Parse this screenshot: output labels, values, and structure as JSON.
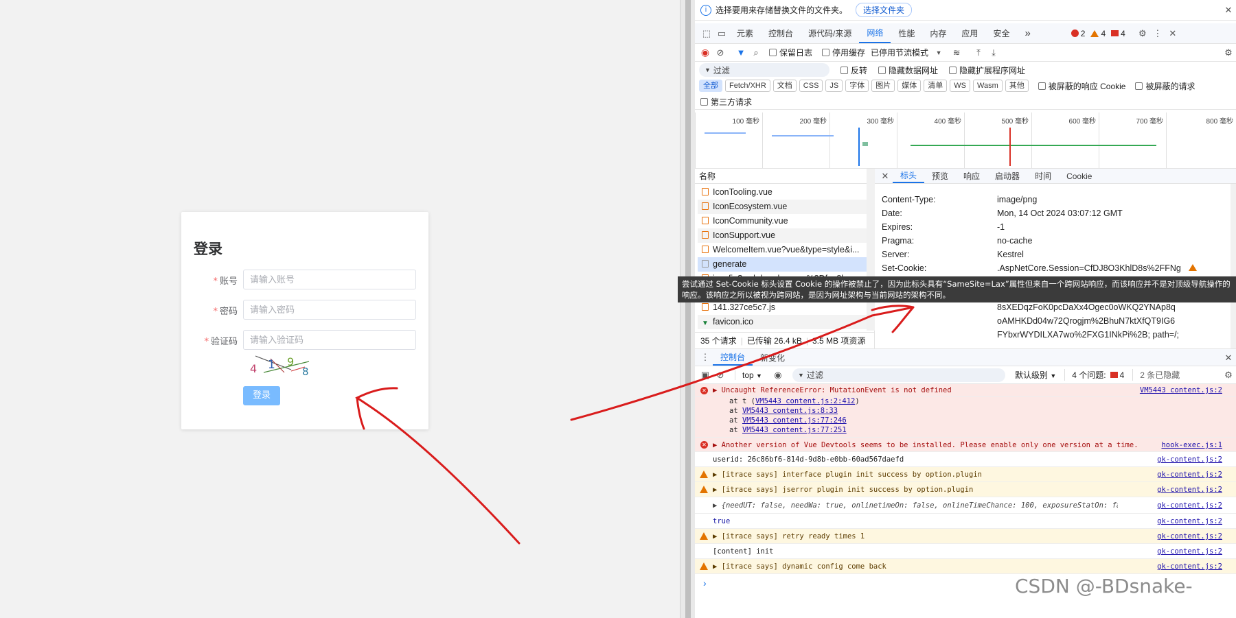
{
  "login": {
    "title": "登录",
    "required_mark": "*",
    "account_label": "账号",
    "account_placeholder": "请输入账号",
    "password_label": "密码",
    "password_placeholder": "请输入密码",
    "captcha_label": "验证码",
    "captcha_placeholder": "请输入验证码",
    "captcha_chars": [
      "4",
      "1",
      "9",
      "8"
    ],
    "submit_label": "登录"
  },
  "devtools": {
    "info_message": "选择要用来存储替换文件的文件夹。",
    "info_button": "选择文件夹",
    "tabs": [
      "元素",
      "控制台",
      "源代码/来源",
      "网络",
      "性能",
      "内存",
      "应用",
      "安全"
    ],
    "active_tab": "网络",
    "more_tabs": "»",
    "error_count": "2",
    "warning_count": "4",
    "issue_count": "4",
    "toolbar": {
      "preserve_log": "保留日志",
      "disable_cache": "停用缓存",
      "throttling": "已停用节流模式"
    },
    "filter": {
      "placeholder": "过滤",
      "invert": "反转",
      "hide_data_urls": "隐藏数据网址",
      "hide_extension_urls": "隐藏扩展程序网址"
    },
    "type_chips": [
      "全部",
      "Fetch/XHR",
      "文档",
      "CSS",
      "JS",
      "字体",
      "图片",
      "媒体",
      "清单",
      "WS",
      "Wasm",
      "其他"
    ],
    "blocked_cookies": "被屏蔽的响应 Cookie",
    "blocked_requests": "被屏蔽的请求",
    "third_party": "第三方请求",
    "timeline_ticks": [
      "100 毫秒",
      "200 毫秒",
      "300 毫秒",
      "400 毫秒",
      "500 毫秒",
      "600 毫秒",
      "700 毫秒",
      "800 毫秒"
    ],
    "name_header": "名称",
    "requests": [
      "IconTooling.vue",
      "IconEcosystem.vue",
      "IconCommunity.vue",
      "IconSupport.vue",
      "WelcomeItem.vue?vue&type=style&i...",
      "generate",
      "iconfig?wpk-header=app%3Dfqy8bg...",
      "",
      "141.327ce5c7.js",
      "favicon.ico"
    ],
    "selected_request": "generate",
    "status_bar": {
      "count": "35 个请求",
      "transferred": "已传输 26.4 kB",
      "resources": "3.5 MB 项资源"
    },
    "detail_tabs": [
      "标头",
      "预览",
      "响应",
      "启动器",
      "时间",
      "Cookie"
    ],
    "headers": [
      {
        "k": "Content-Type:",
        "v": "image/png"
      },
      {
        "k": "Date:",
        "v": "Mon, 14 Oct 2024 03:07:12 GMT"
      },
      {
        "k": "Expires:",
        "v": "-1"
      },
      {
        "k": "Pragma:",
        "v": "no-cache"
      },
      {
        "k": "Server:",
        "v": "Kestrel"
      },
      {
        "k": "Set-Cookie:",
        "v": ".AspNetCore.Session=CfDJ8O3KhlD8s%2FFNg"
      }
    ],
    "cookie_continuation": [
      "8sXEDqzFoK0pcDaXx4Ogec0oWKQ2YNAp8q",
      "oAMHKDd04w72Qrogjm%2BhuN7ktXfQT9IG6",
      "FYbxrWYDILXA7wo%2FXG1INkPi%2B; path=/;"
    ],
    "tooltip": "尝试通过 Set-Cookie 标头设置 Cookie 的操作被禁止了，因为此标头具有“SameSite=Lax”属性但来自一个跨网站响应，而该响应并不是对顶级导航操作的响应。该响应之所以被视为跨网站，是因为网址架构与当前网站的架构不同。",
    "drawer_tabs": [
      "控制台",
      "新变化"
    ],
    "console_toolbar": {
      "context": "top",
      "filter_placeholder": "过滤",
      "levels": "默认级别",
      "issues_label": "4 个问题:",
      "issues_count": "4",
      "hidden": "2 条已隐藏"
    },
    "console": [
      {
        "level": "error",
        "msg": "▶ Uncaught ReferenceError: MutationEvent is not defined",
        "src": "VM5443 content.js:2"
      },
      {
        "level": "stack",
        "msg": "at t (",
        "link": "VM5443 content.js:2:412",
        "tail": ")"
      },
      {
        "level": "stack",
        "msg": "at ",
        "link": "VM5443 content.js:8:33",
        "tail": ""
      },
      {
        "level": "stack",
        "msg": "at ",
        "link": "VM5443 content.js:77:246",
        "tail": ""
      },
      {
        "level": "stack",
        "msg": "at ",
        "link": "VM5443 content.js:77:251",
        "tail": ""
      },
      {
        "level": "error",
        "msg": "▶ Another version of Vue Devtools seems to be installed. Please enable only one version at a time.",
        "src": "hook-exec.js:1"
      },
      {
        "level": "info",
        "msg": "userid: 26c86bf6-814d-9d8b-e0bb-60ad567daefd",
        "src": "gk-content.js:2"
      },
      {
        "level": "warn",
        "msg": "▶ [itrace says] interface plugin init success by option.plugin",
        "src": "gk-content.js:2"
      },
      {
        "level": "warn",
        "msg": "▶ [itrace says] jserror plugin init success by option.plugin",
        "src": "gk-content.js:2"
      },
      {
        "level": "info",
        "msg": "▶ {needUT: false, needWa: true, onlinetimeOn: false, onlineTimeChance: 100, exposureStatOn: false, …}",
        "src": "gk-content.js:2"
      },
      {
        "level": "info",
        "msg": "true",
        "src": "gk-content.js:2"
      },
      {
        "level": "warn",
        "msg": "▶ [itrace says] retry ready times 1",
        "src": "gk-content.js:2"
      },
      {
        "level": "info",
        "msg": "[content] init",
        "src": "gk-content.js:2"
      },
      {
        "level": "warn",
        "msg": "▶ [itrace says] dynamic config come back",
        "src": "gk-content.js:2"
      }
    ],
    "prompt": "›"
  },
  "watermark": "CSDN @-BDsnake-",
  "colors": {
    "accent": "#1a73e8",
    "error": "#d93025",
    "warning": "#e37400",
    "annotation": "#d91c1c",
    "login_button": "#79bbff"
  }
}
